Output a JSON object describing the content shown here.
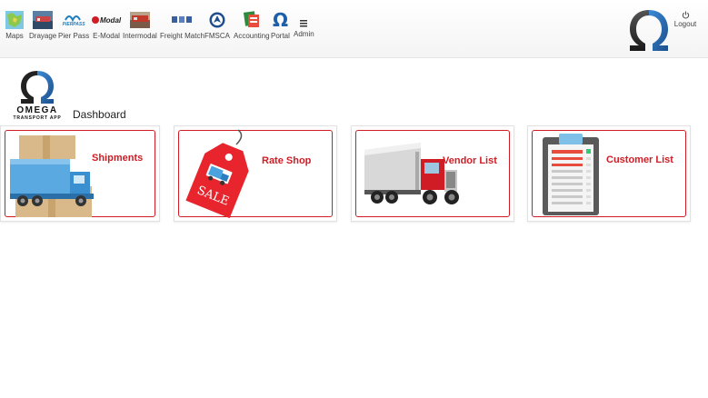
{
  "nav": {
    "items": [
      {
        "label": "Maps",
        "icon": "map-icon"
      },
      {
        "label": "Drayage",
        "icon": "drayage-icon"
      },
      {
        "label": "Pier Pass",
        "icon": "pierpass-icon"
      },
      {
        "label": "E-Modal",
        "icon": "emodal-icon"
      },
      {
        "label": "Intermodal",
        "icon": "intermodal-icon"
      },
      {
        "label": "Freight Match",
        "icon": "freight-match-icon"
      },
      {
        "label": "FMSCA",
        "icon": "fmsca-icon"
      },
      {
        "label": "Accounting",
        "icon": "accounting-icon"
      },
      {
        "label": "Portal",
        "icon": "omega-icon"
      },
      {
        "label": "Admin",
        "icon": "menu-icon"
      }
    ],
    "pierpass_logo_text": "PIERPASS",
    "emodal_logo_text": "Modal",
    "logout_label": "Logout"
  },
  "brand": {
    "name": "OMEGA",
    "tagline": "TRANSPORT APP"
  },
  "page": {
    "title": "Dashboard"
  },
  "cards": [
    {
      "label": "Shipments",
      "icon": "shipments-truck-icon"
    },
    {
      "label": "Rate Shop",
      "icon": "sale-tag-icon",
      "tag_text": "SALE"
    },
    {
      "label": "Vendor List",
      "icon": "semi-truck-icon"
    },
    {
      "label": "Customer List",
      "icon": "clipboard-list-icon"
    }
  ],
  "colors": {
    "accent_red": "#d01c24",
    "omega_blue": "#1d5fa8",
    "omega_dark": "#2a2a2a"
  }
}
